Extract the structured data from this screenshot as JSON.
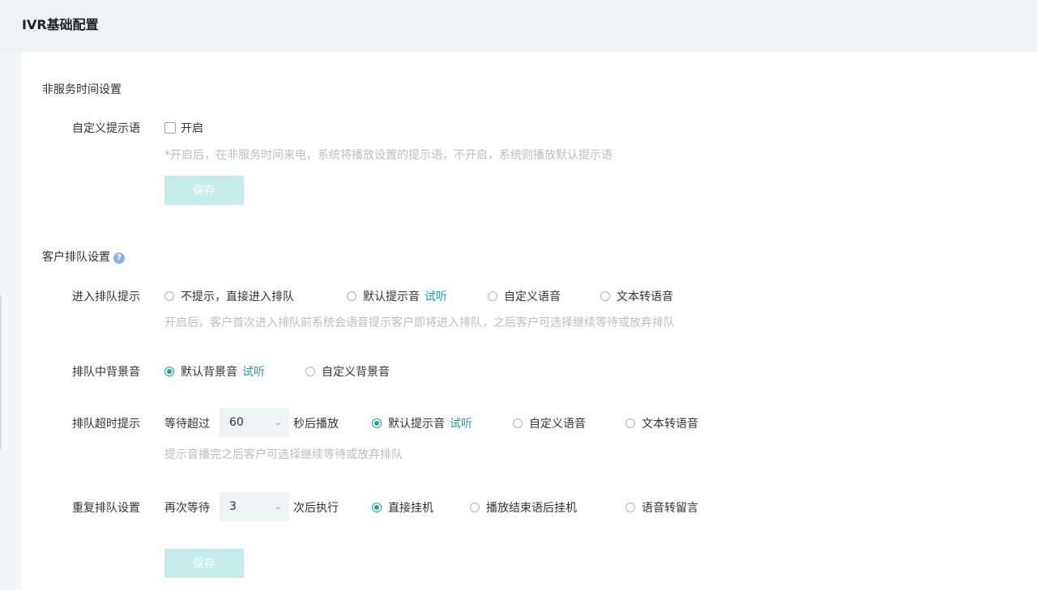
{
  "page": {
    "title": "IVR基础配置"
  },
  "non_service": {
    "title": "非服务时间设置",
    "custom_prompt": {
      "label": "自定义提示语",
      "checkbox_label": "开启",
      "hint": "*开启后，在非服务时间来电，系统将播放设置的提示语，不开启，系统则播放默认提示语"
    },
    "save_label": "保存"
  },
  "queue": {
    "title": "客户排队设置",
    "help_icon": "?",
    "enter_prompt": {
      "label": "进入排队提示",
      "options": [
        "不提示，直接进入排队",
        "默认提示音",
        "自定义语音",
        "文本转语音"
      ],
      "selected": "none",
      "listen_label": "试听",
      "hint": "开启后，客户首次进入排队前系统会语音提示客户即将进入排队，之后客户可选择继续等待或放弃排队"
    },
    "bg_music": {
      "label": "排队中背景音",
      "options": [
        "默认背景音",
        "自定义背景音"
      ],
      "selected": "默认背景音",
      "listen_label": "试听"
    },
    "timeout": {
      "label": "排队超时提示",
      "prefix": "等待超过",
      "value": "60",
      "suffix": "秒后播放",
      "options": [
        "默认提示音",
        "自定义语音",
        "文本转语音"
      ],
      "selected": "默认提示音",
      "listen_label": "试听",
      "hint": "提示音播完之后客户可选择继续等待或放弃排队"
    },
    "repeat": {
      "label": "重复排队设置",
      "prefix": "再次等待",
      "value": "3",
      "suffix": "次后执行",
      "options": [
        "直接挂机",
        "播放结束语后挂机",
        "语音转留言"
      ],
      "selected": "直接挂机"
    },
    "save_label": "保存"
  },
  "colors": {
    "accent": "#1aa6a0",
    "button_bg": "#c6ecea",
    "hint": "#b9bec3"
  },
  "icons": {
    "chevron": "chevron-down-icon",
    "help": "help-icon"
  }
}
